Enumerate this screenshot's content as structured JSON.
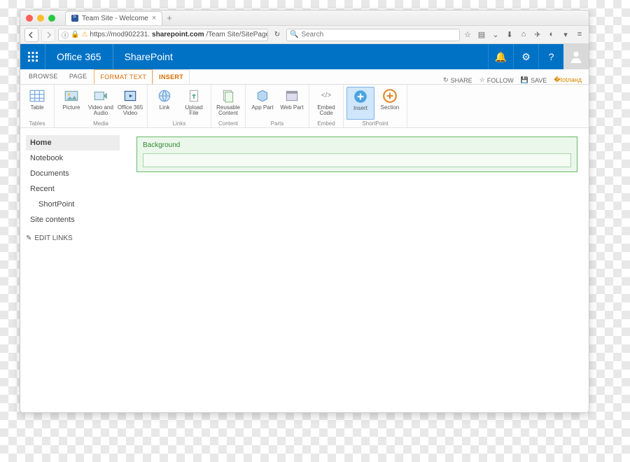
{
  "browser": {
    "tab_title": "Team Site - Welcome",
    "url_prefix": "https://mod902231.",
    "url_domain": "sharepoint.com",
    "url_path": "/Team Site/SitePages/Welcome.aspx?WikiPage",
    "search_placeholder": "Search"
  },
  "suitebar": {
    "brand": "Office 365",
    "app": "SharePoint"
  },
  "ribbon_tabs": {
    "browse": "BROWSE",
    "page": "PAGE",
    "format_text": "FORMAT TEXT",
    "insert": "INSERT"
  },
  "page_actions": {
    "share": "SHARE",
    "follow": "FOLLOW",
    "save": "SAVE"
  },
  "ribbon": {
    "groups": {
      "tables": "Tables",
      "media": "Media",
      "links": "Links",
      "content": "Content",
      "parts": "Parts",
      "embed": "Embed",
      "shortpoint": "ShortPoint"
    },
    "buttons": {
      "table": "Table",
      "picture": "Picture",
      "video_audio": "Video and Audio",
      "o365_video": "Office 365 Video",
      "link": "Link",
      "upload_file": "Upload File",
      "reusable_content": "Reusable Content",
      "app_part": "App Part",
      "web_part": "Web Part",
      "embed_code": "Embed Code",
      "insert": "Insert",
      "section": "Section"
    }
  },
  "leftnav": {
    "home": "Home",
    "notebook": "Notebook",
    "documents": "Documents",
    "recent": "Recent",
    "shortpoint": "ShortPoint",
    "site_contents": "Site contents",
    "edit_links": "EDIT LINKS"
  },
  "editor": {
    "zone_label": "Background"
  }
}
